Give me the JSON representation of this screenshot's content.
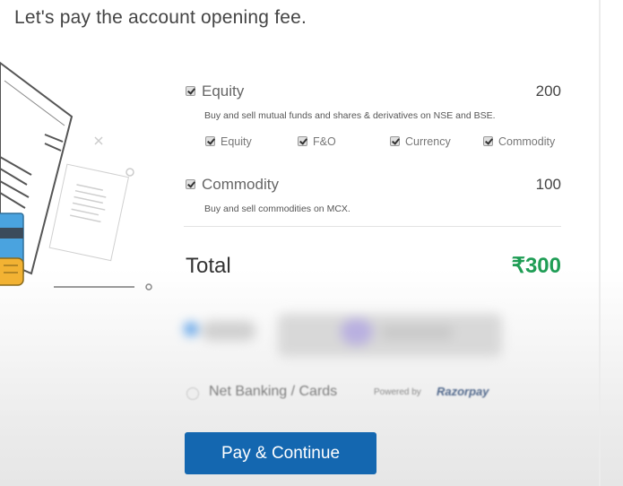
{
  "heading": "Let's pay the account opening fee.",
  "segments": [
    {
      "title": "Equity",
      "amount": "200",
      "description": "Buy and sell mutual funds and shares & derivatives on NSE and BSE.",
      "checked": true,
      "sub_options": [
        {
          "label": "Equity",
          "checked": true
        },
        {
          "label": "F&O",
          "checked": true
        },
        {
          "label": "Currency",
          "checked": true
        },
        {
          "label": "Commodity",
          "checked": true
        }
      ]
    },
    {
      "title": "Commodity",
      "amount": "100",
      "description": "Buy and sell commodities on MCX.",
      "checked": true
    }
  ],
  "total": {
    "label": "Total",
    "amount": "₹300"
  },
  "payment": {
    "method_label": "Net Banking / Cards",
    "powered_by": "Powered by",
    "provider": "Razorpay"
  },
  "pay_button": "Pay & Continue",
  "colors": {
    "accent": "#1467b0",
    "total": "#1f9d55"
  },
  "icons": [
    "checkbox-checked-icon",
    "document-illustration",
    "card-icon"
  ]
}
